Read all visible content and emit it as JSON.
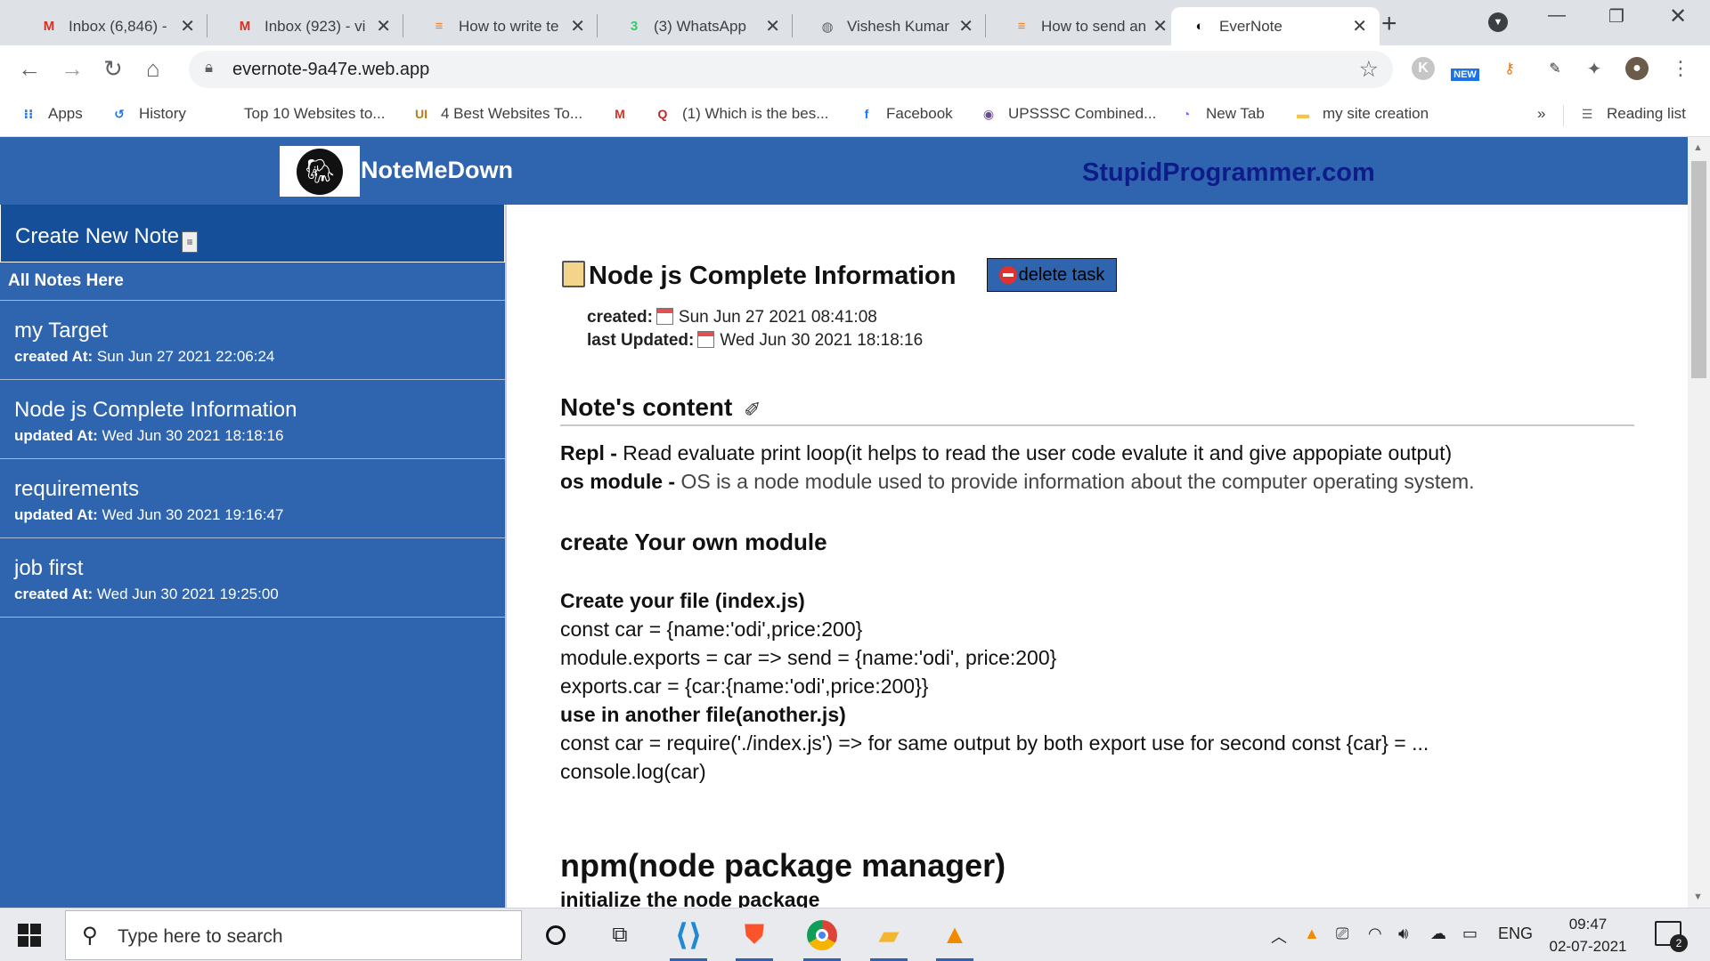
{
  "browser": {
    "tabs": [
      {
        "title": "Inbox (6,846) -",
        "icon": "gmail-icon",
        "glyph": "M",
        "color": "#d93025"
      },
      {
        "title": "Inbox (923) - vi",
        "icon": "gmail-icon",
        "glyph": "M",
        "color": "#d93025"
      },
      {
        "title": "How to write te",
        "icon": "stackoverflow-icon",
        "glyph": "≡",
        "color": "#f48024"
      },
      {
        "title": "(3) WhatsApp",
        "icon": "whatsapp-icon",
        "glyph": "3",
        "color": "#25d366"
      },
      {
        "title": "Vishesh Kumar",
        "icon": "globe-icon",
        "glyph": "◍",
        "color": "#5f6368"
      },
      {
        "title": "How to send an",
        "icon": "stackoverflow-icon",
        "glyph": "≡",
        "color": "#f48024"
      },
      {
        "title": "EverNote",
        "icon": "evernote-icon",
        "glyph": "◐",
        "color": "#111111"
      }
    ],
    "url": "evernote-9a47e.web.app",
    "bookmarks": [
      {
        "label": "Apps",
        "icon": "apps-grid-icon",
        "glyph": "⁝⁝",
        "color": "#1a73e8"
      },
      {
        "label": "History",
        "icon": "history-icon",
        "glyph": "↺",
        "color": "#1a73e8"
      },
      {
        "label": "Top 10 Websites to...",
        "icon": "",
        "glyph": "",
        "color": "#000000"
      },
      {
        "label": "4 Best Websites To...",
        "icon": "site-ui-icon",
        "glyph": "UI",
        "color": "#c07a1a"
      },
      {
        "label": "",
        "icon": "gmail-icon",
        "glyph": "M",
        "color": "#d93025"
      },
      {
        "label": "(1) Which is the bes...",
        "icon": "quora-icon",
        "glyph": "Q",
        "color": "#b92b27"
      },
      {
        "label": "Facebook",
        "icon": "facebook-icon",
        "glyph": "f",
        "color": "#1877f2"
      },
      {
        "label": "UPSSSC Combined...",
        "icon": "upsssc-icon",
        "glyph": "◉",
        "color": "#6a4c93"
      },
      {
        "label": "New Tab",
        "icon": "new-tab-icon",
        "glyph": "◔",
        "color": "#7b61ff"
      },
      {
        "label": "my site creation",
        "icon": "folder-icon",
        "glyph": "▬",
        "color": "#f5c542"
      }
    ],
    "overflow": "»",
    "reading_list": "Reading list",
    "ext_new_badge": "NEW"
  },
  "app": {
    "brand": "NoteMeDown",
    "site": "StupidProgrammer.com"
  },
  "sidebar": {
    "create": "Create New Note",
    "all_notes": "All Notes Here",
    "notes": [
      {
        "title": "my Target",
        "meta_label": "created At:",
        "meta_value": "Sun Jun 27 2021 22:06:24"
      },
      {
        "title": "Node js Complete Information",
        "meta_label": "updated At:",
        "meta_value": "Wed Jun 30 2021 18:18:16"
      },
      {
        "title": "requirements",
        "meta_label": "updated At:",
        "meta_value": "Wed Jun 30 2021 19:16:47"
      },
      {
        "title": "job first",
        "meta_label": "created At:",
        "meta_value": "Wed Jun 30 2021 19:25:00"
      }
    ]
  },
  "note": {
    "title": "Node js Complete Information",
    "delete_label": "delete task",
    "created_label": "created:",
    "created_value": "Sun Jun 27 2021 08:41:08",
    "updated_label": "last Updated:",
    "updated_value": "Wed Jun 30 2021 18:18:16",
    "content_heading": "Note's content",
    "repl_term": "Repl -",
    "repl_text": "Read evaluate print loop(it helps to read the user code evalute it and give appopiate output)",
    "os_term": "os module -",
    "os_text": "OS is a node module used to provide information about the computer operating system.",
    "module_heading": "create Your own module",
    "create_file": "Create your file (index.js)",
    "code1": "const car = {name:'odi',price:200}",
    "code2": "module.exports = car => send = {name:'odi', price:200}",
    "code3": "exports.car = {car:{name:'odi',price:200}}",
    "use_another": "use in another file(another.js)",
    "code4": "const car = require('./index.js') => for same output by both export use for second const {car} = ...",
    "code5": "console.log(car)",
    "npm_heading": "npm(node package manager)",
    "init_heading": "initialize the node package"
  },
  "taskbar": {
    "search_placeholder": "Type here to search",
    "lang": "ENG",
    "time": "09:47",
    "date": "02-07-2021",
    "notifications": "2"
  }
}
